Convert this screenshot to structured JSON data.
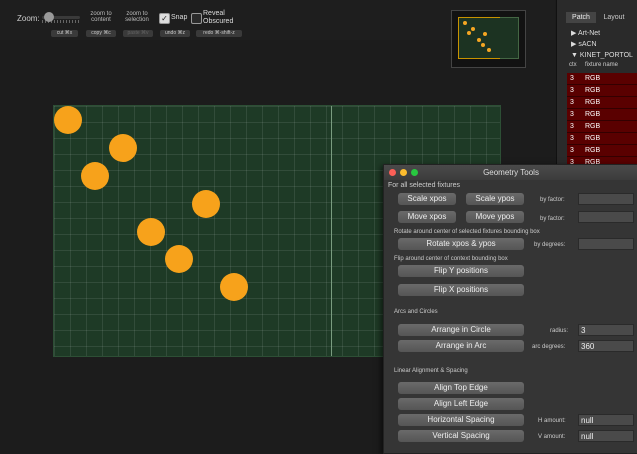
{
  "toolbar": {
    "zoom_label": "Zoom:",
    "zoom_to_content": [
      "zoom to",
      "content"
    ],
    "zoom_to_selection": [
      "zoom to",
      "selection"
    ],
    "snap_label": "Snap",
    "reveal_obscured": [
      "Reveal",
      "Obscured"
    ],
    "snap_checked": true,
    "reveal_checked": false,
    "cut": "cut ⌘x",
    "copy": "copy ⌘c",
    "paste": "paste ⌘v",
    "undo": "undo ⌘z",
    "redo": "redo ⌘-shift-z"
  },
  "right_panel": {
    "tabs": [
      "Patch",
      "Layout"
    ],
    "tree": [
      "▶ Art-Net",
      "▶ sACN",
      "▼ KINET_PORTOL"
    ],
    "columns": [
      "ctx",
      "fixture name"
    ],
    "rows": [
      {
        "ctx": "3",
        "name": "RGB"
      },
      {
        "ctx": "3",
        "name": "RGB"
      },
      {
        "ctx": "3",
        "name": "RGB"
      },
      {
        "ctx": "3",
        "name": "RGB"
      },
      {
        "ctx": "3",
        "name": "RGB"
      },
      {
        "ctx": "3",
        "name": "RGB"
      },
      {
        "ctx": "3",
        "name": "RGB"
      },
      {
        "ctx": "3",
        "name": "RGB"
      }
    ]
  },
  "geometry_tools": {
    "title": "Geometry Tools",
    "for_all": "For all selected fixtures",
    "scale_xpos": "Scale xpos",
    "scale_ypos": "Scale ypos",
    "by_factor": "by factor:",
    "move_xpos": "Move xpos",
    "move_ypos": "Move ypos",
    "rotate_label": "Rotate around center of selected fixtures bounding box",
    "rotate_button": "Rotate xpos & ypos",
    "by_degrees": "by degrees:",
    "flip_label": "Flip around center of context bounding box",
    "flip_y": "Flip Y positions",
    "flip_x": "Flip X positions",
    "arcs_header": "Arcs and Circles",
    "arrange_circle": "Arrange in Circle",
    "radius_label": "radius:",
    "radius_value": "3",
    "arrange_arc": "Arrange in Arc",
    "arc_degrees_label": "arc degrees:",
    "arc_degrees_value": "360",
    "linear_header": "Linear Alignment & Spacing",
    "align_top": "Align Top Edge",
    "align_left": "Align Left Edge",
    "horizontal_spacing": "Horizontal Spacing",
    "h_amount_label": "H amount:",
    "h_amount_value": "null",
    "vertical_spacing": "Vertical Spacing",
    "v_amount_label": "V amount:",
    "v_amount_value": "null"
  },
  "colors": {
    "fixture": "#f7a21b",
    "canvas_bg": "#1e3a26",
    "row_bg": "#5a0000"
  }
}
